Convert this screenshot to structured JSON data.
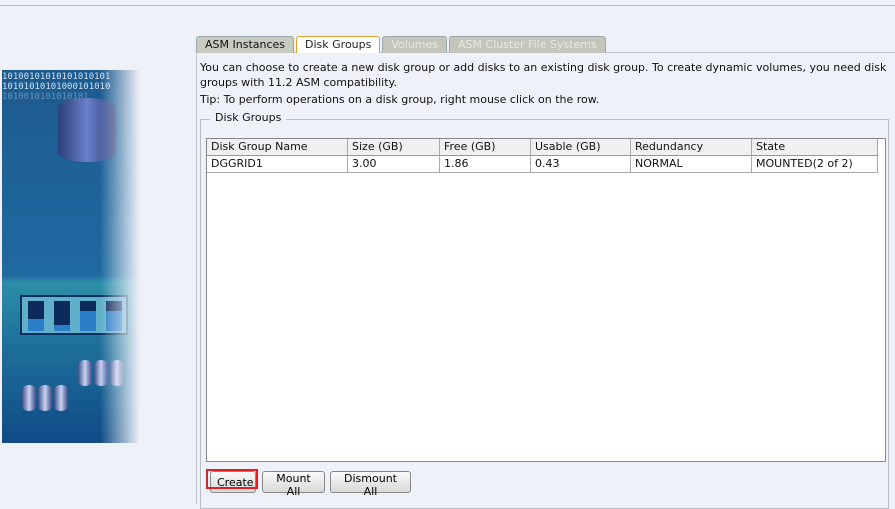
{
  "tabs": [
    {
      "label": "ASM Instances",
      "state": "normal"
    },
    {
      "label": "Disk Groups",
      "state": "active"
    },
    {
      "label": "Volumes",
      "state": "disabled"
    },
    {
      "label": "ASM Cluster File Systems",
      "state": "disabled"
    }
  ],
  "description": "You can choose to create a new disk group or add disks to an existing disk group. To create dynamic volumes, you need disk groups with 11.2 ASM compatibility.",
  "tip": "Tip: To perform operations on a disk group, right mouse click on the row.",
  "group_title": "Disk Groups",
  "art_bits": [
    "10100101010101010101",
    "10101010101000101010",
    "1010010101010101"
  ],
  "table": {
    "columns": [
      "Disk Group Name",
      "Size (GB)",
      "Free (GB)",
      "Usable (GB)",
      "Redundancy",
      "State"
    ],
    "rows": [
      [
        "DGGRID1",
        "3.00",
        "1.86",
        "0.43",
        "NORMAL",
        "MOUNTED(2 of 2)"
      ]
    ]
  },
  "buttons": {
    "create": "Create",
    "mount_all": "Mount All",
    "dismount_all": "Dismount All"
  },
  "highlight_color": "#e02020"
}
